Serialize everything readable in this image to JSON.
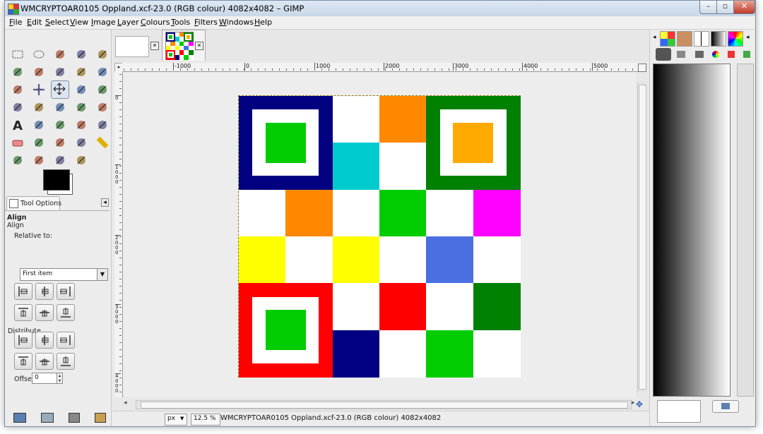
{
  "window": {
    "title": "WMCRYPTOAR0105 Oppland.xcf-23.0 (RGB colour) 4082x4082 – GIMP",
    "minimize_glyph": "–",
    "maximize_glyph": "▫",
    "close_glyph": "✕"
  },
  "menu": {
    "items": [
      "File",
      "Edit",
      "Select",
      "View",
      "Image",
      "Layer",
      "Colours",
      "Tools",
      "Filters",
      "Windows",
      "Help"
    ]
  },
  "tools": [
    [
      "rect-select-icon",
      "ellipse-select-icon",
      "free-select-icon",
      "fuzzy-select-icon",
      "select-by-color-icon"
    ],
    [
      "scissors-icon",
      "foreground-select-icon",
      "paths-icon",
      "color-picker-icon",
      "zoom-icon"
    ],
    [
      "measure-icon",
      "move-icon",
      "align-icon",
      "crop-icon",
      "rotate-icon"
    ],
    [
      "scale-icon",
      "shear-icon",
      "perspective-icon",
      "flip-icon",
      "cage-icon"
    ],
    [
      "text-icon",
      "bucket-fill-icon",
      "blend-icon",
      "pencil-icon",
      "paintbrush-icon"
    ],
    [
      "eraser-icon",
      "airbrush-icon",
      "ink-icon",
      "clone-icon",
      "heal-icon"
    ],
    [
      "perspective-clone-icon",
      "blur-icon",
      "smudge-icon",
      "dodge-burn-icon"
    ]
  ],
  "colors": {
    "foreground": "#000000",
    "background": "#ffffff"
  },
  "tool_options": {
    "tab_label": "Tool Options",
    "header": "Align",
    "subheader": "Align",
    "relative_to_label": "Relative to:",
    "relative_to_value": "First item",
    "distribute_label": "Distribute",
    "offset_label": "Offset:",
    "offset_value": "0"
  },
  "rulers": {
    "h_labels": [
      "-1000",
      "0",
      "1000",
      "2000",
      "3000",
      "4000",
      "5000"
    ],
    "v_labels": [
      "0",
      "1000",
      "2000",
      "3000",
      "4000"
    ]
  },
  "status": {
    "unit": "px",
    "zoom": "12.5 %",
    "text": "WMCRYPTOAR0105 Oppland.xcf-23.0 (RGB colour) 4082x4082"
  },
  "image_grid": {
    "rows": [
      [
        "#000080",
        "#000080",
        "#ffffff",
        "#ff8800",
        "#008000",
        "#008000"
      ],
      [
        "#000080",
        "#000080",
        "#00ccd0",
        "#ffffff",
        "#008000",
        "#008000"
      ],
      [
        "#ffffff",
        "#ff8800",
        "#ffffff",
        "#00cc00",
        "#ffffff",
        "#ff00ff"
      ],
      [
        "#ffff00",
        "#ffffff",
        "#ffff00",
        "#ffffff",
        "#4a6fe0",
        "#ffffff"
      ],
      [
        "#ff0000",
        "#ff0000",
        "#ffffff",
        "#ff0000",
        "#ffffff",
        "#008000"
      ],
      [
        "#ff0000",
        "#ff0000",
        "#000080",
        "#ffffff",
        "#00cc00",
        "#ffffff"
      ]
    ],
    "finder_centers": [
      "#00cc00",
      "#ffaa00",
      "#00cc00"
    ]
  }
}
